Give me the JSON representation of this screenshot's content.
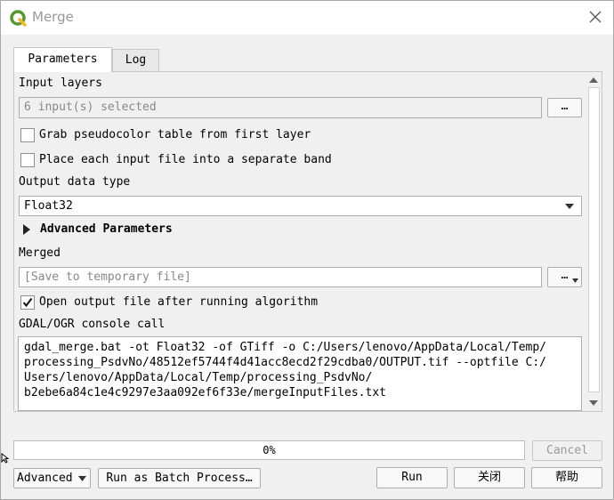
{
  "window": {
    "title": "Merge",
    "accent_color": "#589632"
  },
  "tabs": [
    {
      "label": "Parameters",
      "active": true
    },
    {
      "label": "Log",
      "active": false
    }
  ],
  "form": {
    "input_layers_label": "Input layers",
    "input_layers_value": "6 input(s) selected",
    "browse_label": "…",
    "pseudocolor_label": "Grab pseudocolor table from first layer",
    "pseudocolor_checked": false,
    "separate_band_label": "Place each input file into a separate band",
    "separate_band_checked": false,
    "output_type_label": "Output data type",
    "output_type_value": "Float32",
    "advanced_params_label": "Advanced Parameters",
    "merged_label": "Merged",
    "merged_placeholder": "[Save to temporary file]",
    "merged_browse_label": "…",
    "open_output_label": "Open output file after running algorithm",
    "open_output_checked": true,
    "console_label": "GDAL/OGR console call",
    "console_text": "gdal_merge.bat -ot Float32 -of GTiff -o C:/Users/lenovo/AppData/Local/Temp/\nprocessing_PsdvNo/48512ef5744f4d41acc8ecd2f29cdba0/OUTPUT.tif --optfile C:/\nUsers/lenovo/AppData/Local/Temp/processing_PsdvNo/\nb2ebe6a84c1e4c9297e3aa092ef6f33e/mergeInputFiles.txt"
  },
  "progress": {
    "value": 0,
    "label": "0%"
  },
  "footer": {
    "cancel_label": "Cancel",
    "advanced_label": "Advanced",
    "batch_label": "Run as Batch Process…",
    "run_label": "Run",
    "close_label": "关闭",
    "help_label": "帮助"
  }
}
